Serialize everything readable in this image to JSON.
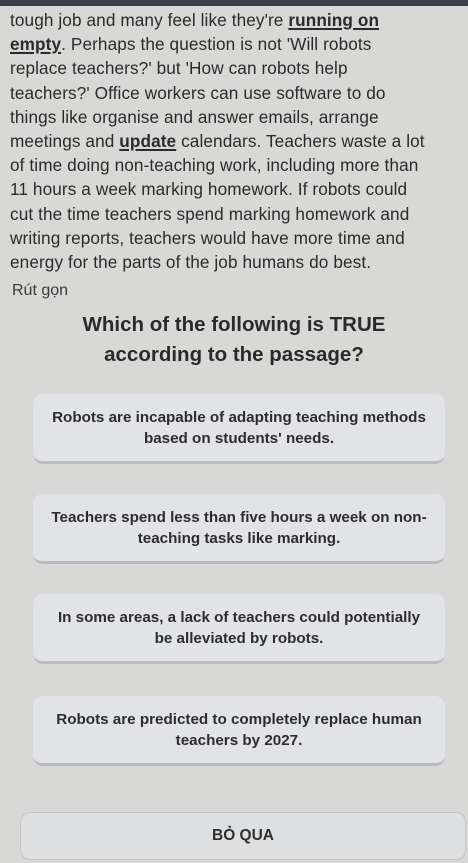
{
  "passage": {
    "lines": [
      [
        "tough job and many feel like they're ",
        "running on"
      ],
      [
        "empty",
        ". Perhaps the question is not 'Will robots"
      ],
      [
        "replace teachers?' but 'How can robots help"
      ],
      [
        "teachers?' Office workers can use software to do"
      ],
      [
        "things like organise and answer emails, arrange"
      ],
      [
        "meetings and ",
        "update",
        " calendars. Teachers waste a lot"
      ],
      [
        "of time doing non-teaching work, including more than"
      ],
      [
        "11 hours a week marking homework. If robots could"
      ],
      [
        "cut the time teachers spend marking homework and"
      ],
      [
        "writing reports, teachers would have more time and"
      ],
      [
        "energy for the parts of the job humans do best."
      ]
    ]
  },
  "collapse_label": "Rút gọn",
  "question": {
    "line1": "Which of the following is TRUE",
    "line2": "according to the passage?"
  },
  "options": [
    "Robots are incapable of adapting teaching methods based on students' needs.",
    "Teachers spend less than five hours a week on non-teaching tasks like marking.",
    "In some areas, a lack of teachers could potentially be alleviated by robots.",
    "Robots are predicted to completely replace human teachers by 2027."
  ],
  "skip_label": "BỎ QUA",
  "colors": {
    "background": "#d8d8d6",
    "option_bg": "#e2e3e6",
    "text": "#2c2c2c"
  }
}
